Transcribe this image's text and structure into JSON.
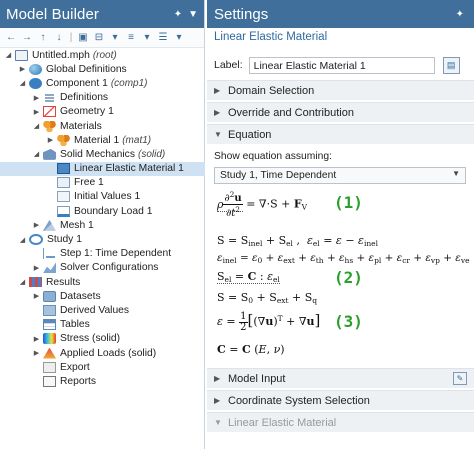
{
  "model_builder": {
    "title": "Model Builder",
    "tree": [
      {
        "label": "Untitled.mph",
        "tag": "(root)"
      },
      {
        "label": "Global Definitions"
      },
      {
        "label": "Component 1",
        "tag": "(comp1)"
      },
      {
        "label": "Definitions"
      },
      {
        "label": "Geometry 1"
      },
      {
        "label": "Materials"
      },
      {
        "label": "Material 1",
        "tag": "(mat1)"
      },
      {
        "label": "Solid Mechanics",
        "tag": "(solid)"
      },
      {
        "label": "Linear Elastic Material 1"
      },
      {
        "label": "Free 1"
      },
      {
        "label": "Initial Values 1"
      },
      {
        "label": "Boundary Load 1"
      },
      {
        "label": "Mesh 1"
      },
      {
        "label": "Study 1"
      },
      {
        "label": "Step 1: Time Dependent"
      },
      {
        "label": "Solver Configurations"
      },
      {
        "label": "Results"
      },
      {
        "label": "Datasets"
      },
      {
        "label": "Derived Values"
      },
      {
        "label": "Tables"
      },
      {
        "label": "Stress (solid)"
      },
      {
        "label": "Applied Loads (solid)"
      },
      {
        "label": "Export"
      },
      {
        "label": "Reports"
      }
    ]
  },
  "settings": {
    "title": "Settings",
    "subtitle": "Linear Elastic Material",
    "label_key": "Label:",
    "label_value": "Linear Elastic Material 1",
    "sections": {
      "domain": "Domain Selection",
      "override": "Override and Contribution",
      "equation": "Equation",
      "model_input": "Model Input",
      "coord": "Coordinate System Selection",
      "lem": "Linear Elastic Material"
    },
    "show_equation_label": "Show equation assuming:",
    "study_option": "Study 1, Time Dependent",
    "eq_numbers": [
      "(1)",
      "(2)",
      "(3)"
    ]
  },
  "colors": {
    "header_bg": "#3f6f9a",
    "selection": "#cfe2f3",
    "eq_number": "#2aa02a"
  }
}
